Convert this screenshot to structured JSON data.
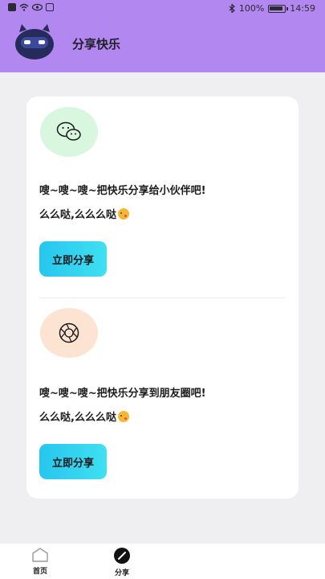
{
  "status_bar": {
    "battery": "100%",
    "time": "14:59"
  },
  "header": {
    "title": "分享快乐",
    "avatar_icon": "robot-mascot-icon"
  },
  "share_sections": [
    {
      "icon": "wechat-icon",
      "text": "嗖~嗖~嗖~把快乐分享给小伙伴吧!",
      "subtext": "么么哒,么么么哒",
      "emoji": "kiss-face-icon",
      "button_label": "立即分享",
      "circle_color": "#d9f7df"
    },
    {
      "icon": "moments-shutter-icon",
      "text": "嗖~嗖~嗖~把快乐分享到朋友圈吧!",
      "subtext": "么么哒,么么么哒",
      "emoji": "kiss-face-icon",
      "button_label": "立即分享",
      "circle_color": "#fde3d2"
    }
  ],
  "tabbar": {
    "tabs": [
      {
        "label": "首页",
        "icon": "home-icon",
        "active": false
      },
      {
        "label": "分享",
        "icon": "share-pen-icon",
        "active": true
      }
    ]
  },
  "colors": {
    "header_bg": "#b387f0",
    "page_bg": "#efeff1",
    "button_gradient_start": "#27c6ee",
    "button_gradient_end": "#3fe0f2"
  }
}
